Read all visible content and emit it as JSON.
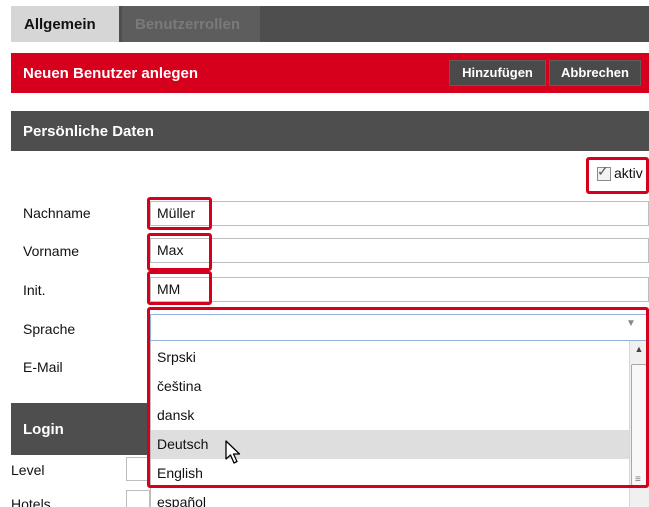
{
  "tabs": [
    {
      "label": "Allgemein",
      "active": true
    },
    {
      "label": "Benutzerrollen",
      "active": false
    }
  ],
  "header": {
    "title": "Neuen Benutzer anlegen",
    "add_label": "Hinzufügen",
    "cancel_label": "Abbrechen"
  },
  "personal": {
    "section_title": "Persönliche Daten",
    "active_label": "aktiv",
    "active_checked": true,
    "fields": {
      "lastname_label": "Nachname",
      "lastname_value": "Müller",
      "firstname_label": "Vorname",
      "firstname_value": "Max",
      "initials_label": "Init.",
      "initials_value": "MM",
      "language_label": "Sprache",
      "language_value": "",
      "email_label": "E-Mail"
    },
    "language_options": [
      "Srpski",
      "čeština",
      "dansk",
      "Deutsch",
      "English",
      "español"
    ],
    "hovered_option": "Deutsch"
  },
  "login": {
    "section_title": "Login",
    "level_label": "Level",
    "hotels_label": "Hotels"
  },
  "colors": {
    "accent_red": "#d6001c",
    "dark_bar": "#4e4e4e"
  }
}
